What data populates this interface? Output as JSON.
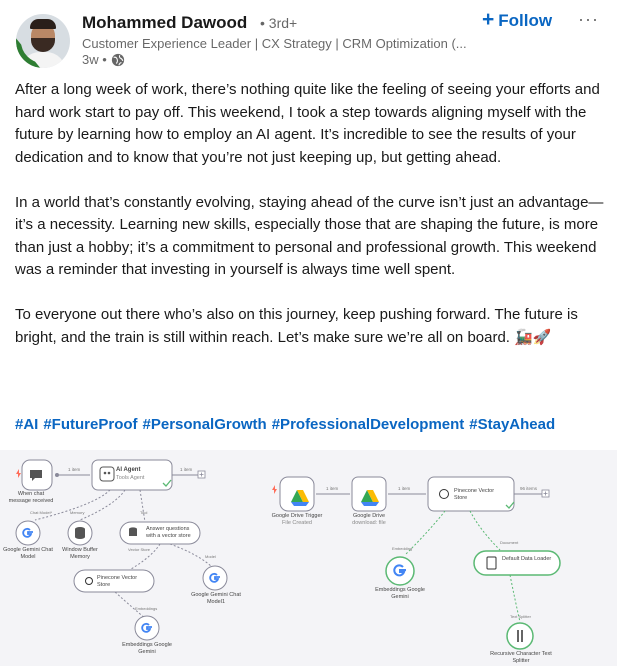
{
  "author": {
    "name": "Mohammed Dawood",
    "degree": "• 3rd+",
    "headline": "Customer Experience Leader | CX Strategy | CRM Optimization (...",
    "time": "3w •",
    "avatar_badge": "#OPENTOWORK"
  },
  "actions": {
    "follow_label": "Follow",
    "more_label": "···"
  },
  "post": {
    "paragraphs": [
      "After a long week of work, there’s nothing quite like the feeling of seeing your efforts and hard work start to pay off. This weekend, I took a step towards aligning myself with the future by learning how to employ an AI agent. It’s incredible to see the results of your dedication and to know that you’re not just keeping up, but getting ahead.",
      "In a world that’s constantly evolving, staying ahead of the curve isn’t just an advantage—it’s a necessity. Learning new skills, especially those that are shaping the future, is more than just a hobby; it’s a commitment to personal and professional growth. This weekend was a reminder that investing in yourself is always time well spent.",
      "To everyone out there who’s also on this journey, keep pushing forward. The future is bright, and the train is still within reach. Let’s make sure we’re all on board. 🚂🚀"
    ],
    "hashtags": [
      "#AI",
      "#FutureProof",
      "#PersonalGrowth",
      "#ProfessionalDevelopment",
      "#StayAhead"
    ]
  },
  "diagram": {
    "left": {
      "trigger": "When chat message received",
      "agent_title": "AI Agent",
      "agent_sub": "Tools Agent",
      "chat_model": "Google Gemini Chat Model",
      "memory": "Window Buffer Memory",
      "tool": "Answer questions with a vector store",
      "vector_store": "Pinecone Vector Store",
      "gemini_model2": "Google Gemini Chat Model1",
      "embeddings": "Embeddings Google Gemini",
      "edge_item": "1 item",
      "labels": [
        "Chat Model*",
        "Memory",
        "Tool",
        "Vector Store",
        "Model",
        "Embeddings"
      ]
    },
    "right": {
      "trigger": "Google Drive Trigger",
      "trigger_sub": "File Created",
      "drive": "Google Drive",
      "drive_sub": "download: file",
      "pinecone": "Pinecone Vector Store",
      "embeddings": "Embeddings Google Gemini",
      "loader": "Default Data Loader",
      "splitter": "Recursive Character Text Splitter",
      "edge_item": "1 item",
      "edge_items": "96 items",
      "labels": [
        "Embedding",
        "Document",
        "Text Splitter"
      ]
    }
  },
  "colors": {
    "accent": "#0a66c2",
    "text": "#191919",
    "muted": "#666666",
    "node_border": "#8a8a9a",
    "node_green": "#5bb974",
    "diagram_bg": "#f4f4f7"
  }
}
